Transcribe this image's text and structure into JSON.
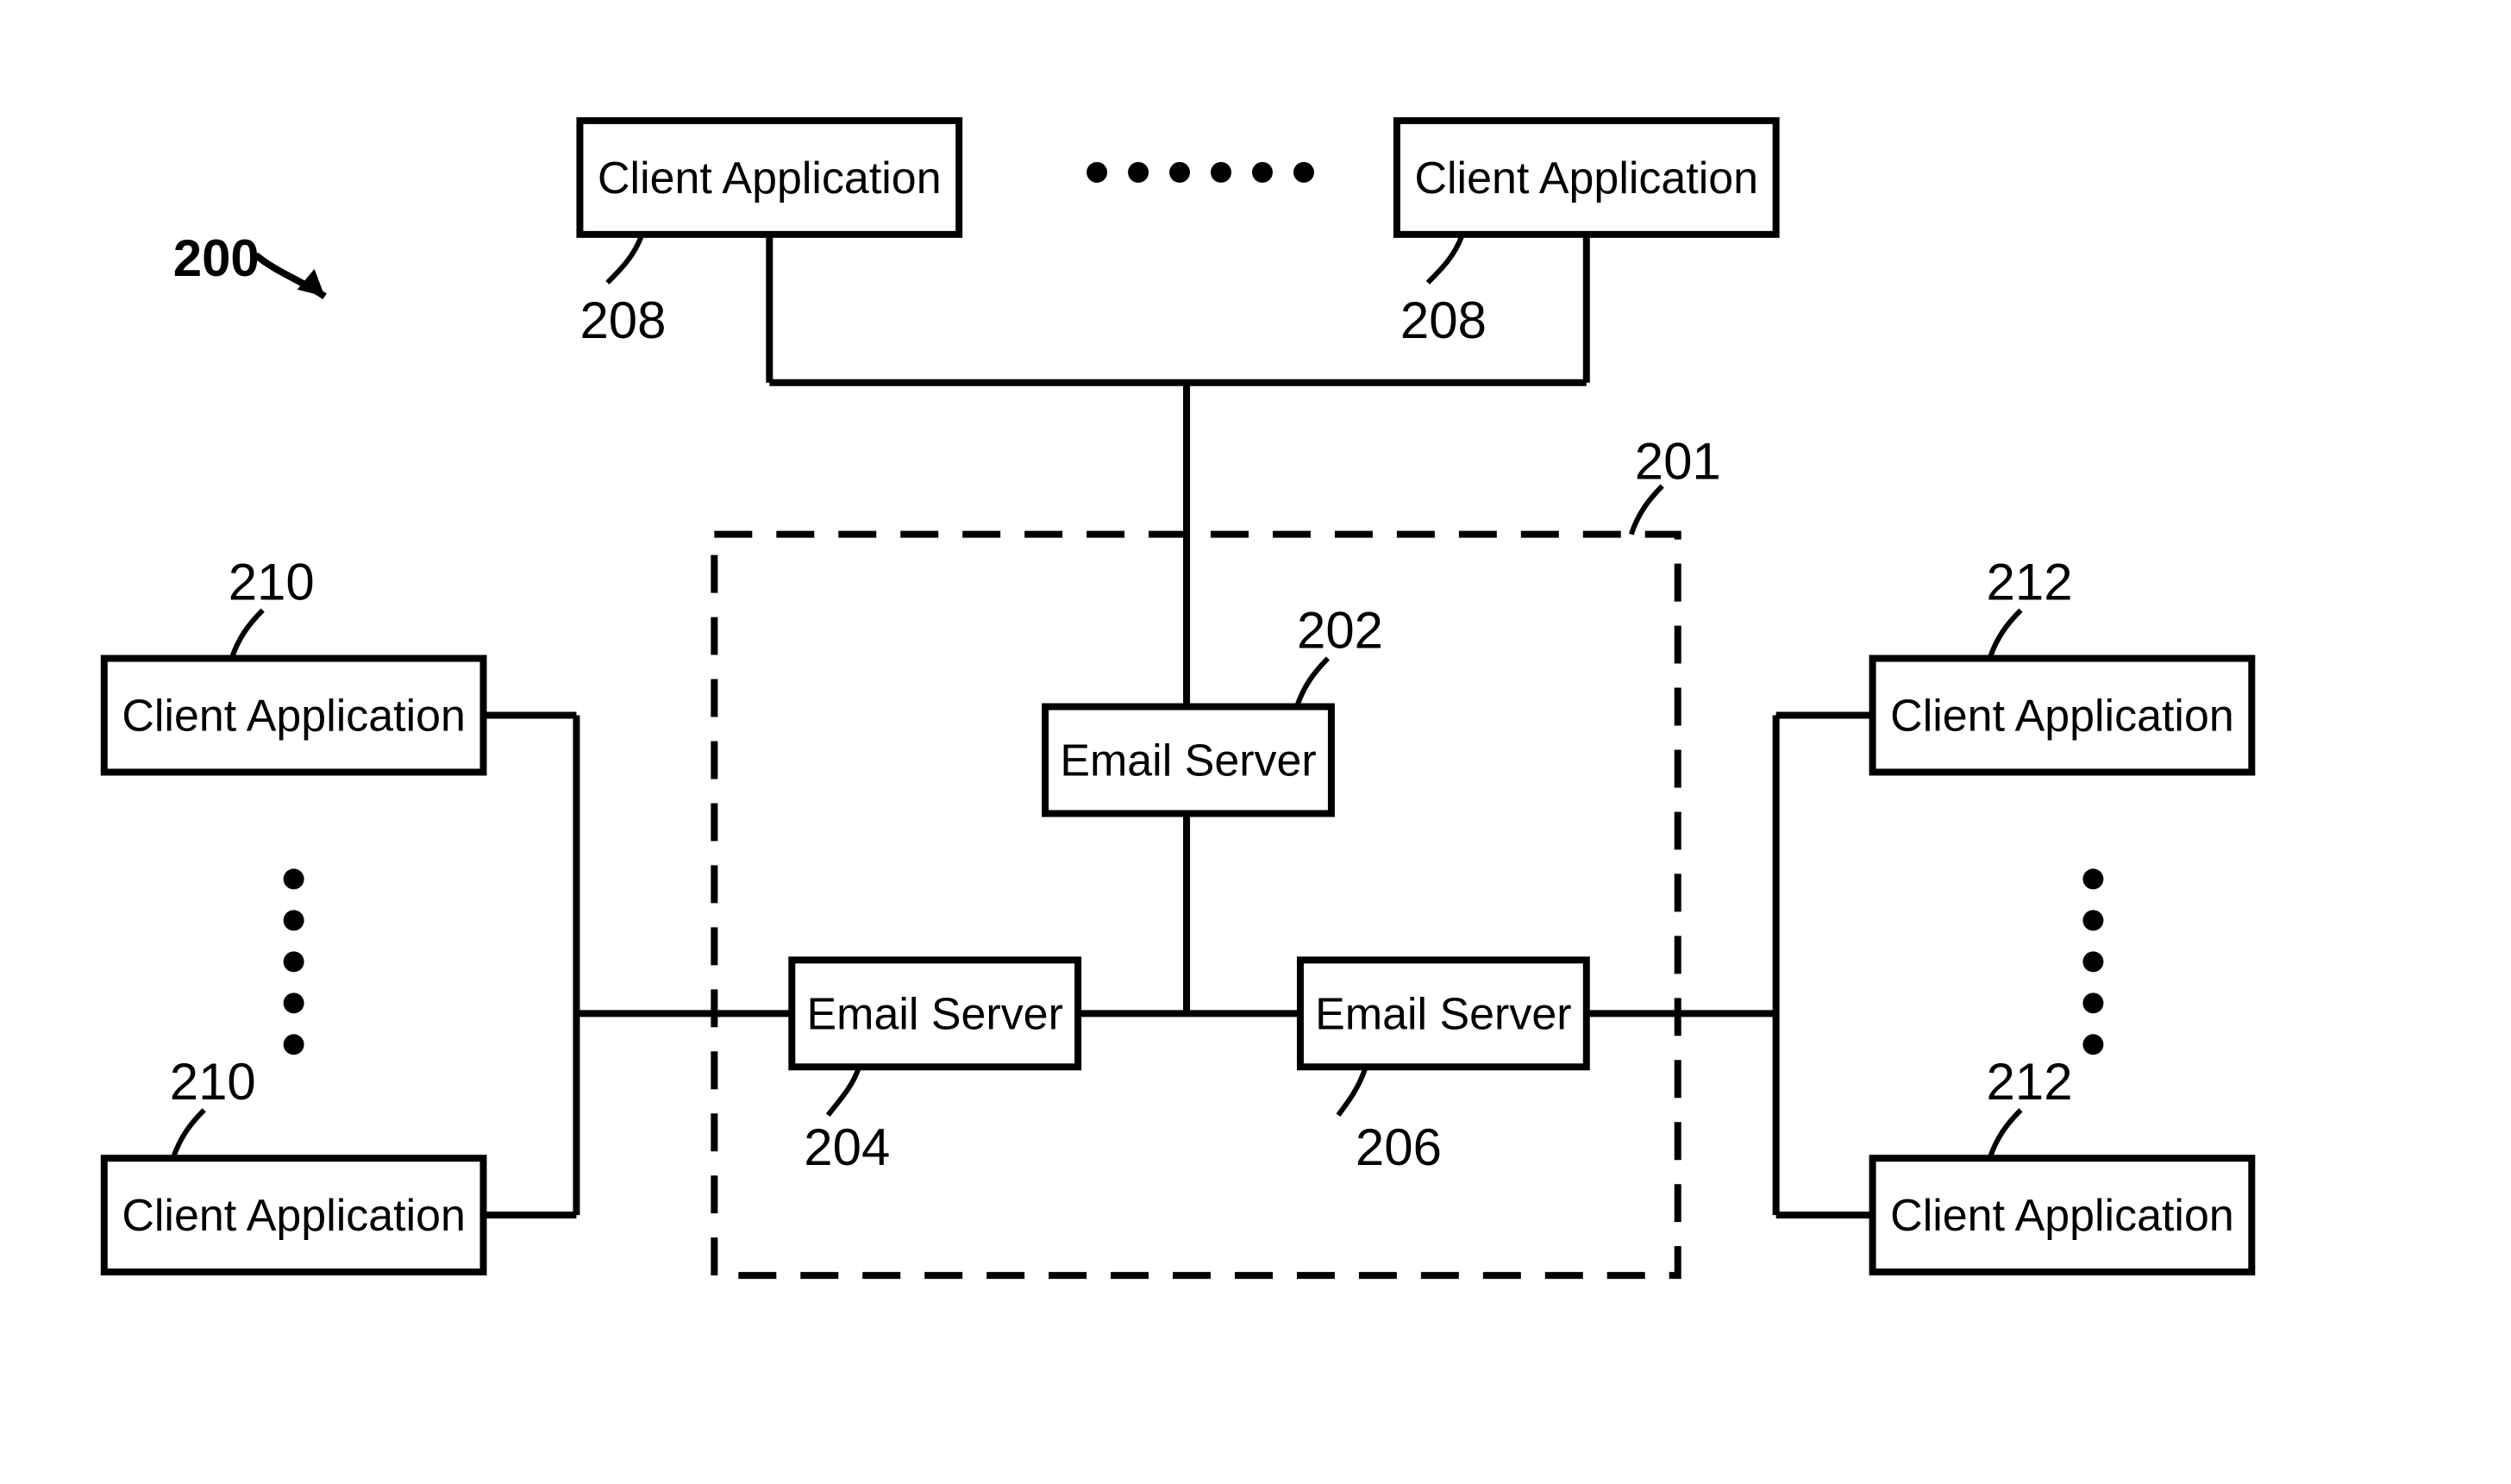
{
  "figure_ref": "200",
  "dashed_box_ref": "201",
  "boxes": {
    "top_client_left": {
      "label": "Client Application",
      "ref": "208"
    },
    "top_client_right": {
      "label": "Client Application",
      "ref": "208"
    },
    "email_top": {
      "label": "Email Server",
      "ref": "202"
    },
    "email_left": {
      "label": "Email Server",
      "ref": "204"
    },
    "email_right": {
      "label": "Email Server",
      "ref": "206"
    },
    "left_client_top": {
      "label": "Client Application",
      "ref": "210"
    },
    "left_client_bot": {
      "label": "Client Application",
      "ref": "210"
    },
    "right_client_top": {
      "label": "Client Application",
      "ref": "212"
    },
    "right_client_bot": {
      "label": "Client Application",
      "ref": "212"
    }
  }
}
